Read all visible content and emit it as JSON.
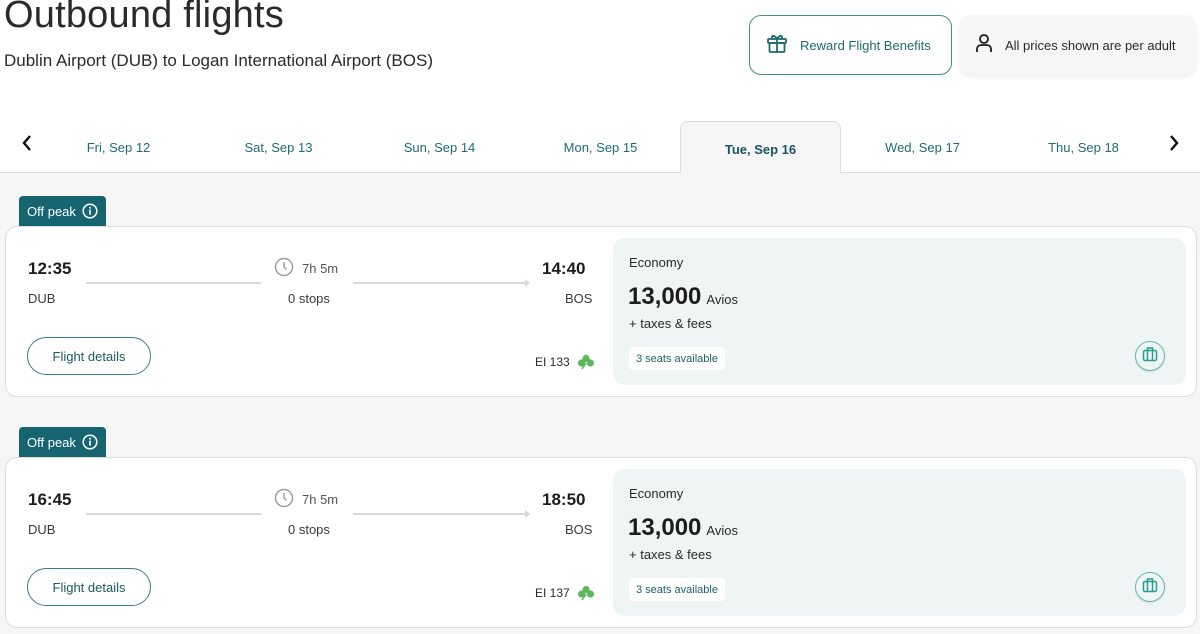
{
  "header": {
    "title": "Outbound flights",
    "subtitle": "Dublin Airport (DUB) to Logan International Airport (BOS)",
    "reward_button": {
      "label": "Reward Flight Benefits",
      "icon": "gift-icon"
    },
    "price_note": {
      "label": "All prices shown are per adult",
      "icon": "person-icon"
    }
  },
  "colors": {
    "brand_teal": "#166470",
    "link_teal": "#1f6a78",
    "fare_bg": "#eff5f5",
    "shamrock_green": "#5cb85c"
  },
  "date_nav": {
    "prev_icon": "chevron-left-icon",
    "next_icon": "chevron-right-icon",
    "dates": [
      {
        "label": "Fri, Sep 12",
        "active": false
      },
      {
        "label": "Sat, Sep 13",
        "active": false
      },
      {
        "label": "Sun, Sep 14",
        "active": false
      },
      {
        "label": "Mon, Sep 15",
        "active": false
      },
      {
        "label": "Tue, Sep 16",
        "active": true
      },
      {
        "label": "Wed, Sep 17",
        "active": false
      },
      {
        "label": "Thu, Sep 18",
        "active": false
      }
    ]
  },
  "flights": [
    {
      "badge": "Off peak",
      "departure_time": "12:35",
      "departure_code": "DUB",
      "arrival_time": "14:40",
      "arrival_code": "BOS",
      "duration": "7h 5m",
      "stops": "0 stops",
      "details_label": "Flight details",
      "flight_number": "EI 133",
      "fare": {
        "cabin": "Economy",
        "price": "13,000",
        "unit": "Avios",
        "taxes": "+ taxes & fees",
        "seats": "3 seats available"
      }
    },
    {
      "badge": "Off peak",
      "departure_time": "16:45",
      "departure_code": "DUB",
      "arrival_time": "18:50",
      "arrival_code": "BOS",
      "duration": "7h 5m",
      "stops": "0 stops",
      "details_label": "Flight details",
      "flight_number": "EI 137",
      "fare": {
        "cabin": "Economy",
        "price": "13,000",
        "unit": "Avios",
        "taxes": "+ taxes & fees",
        "seats": "3 seats available"
      }
    }
  ]
}
